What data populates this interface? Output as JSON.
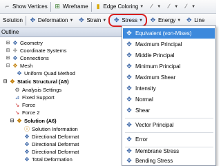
{
  "toolbar1": {
    "show_vertices": "Show Vertices",
    "wireframe": "Wireframe",
    "edge_coloring": "Edge Coloring"
  },
  "toolbar2": {
    "solution": "Solution",
    "deformation": "Deformation",
    "strain": "Strain",
    "stress": "Stress",
    "energy": "Energy",
    "linearized": "Line"
  },
  "outline": {
    "header": "Outline",
    "nodes": [
      {
        "label": "Geometry"
      },
      {
        "label": "Coordinate Systems"
      },
      {
        "label": "Connections"
      },
      {
        "label": "Mesh"
      },
      {
        "label": "Uniform Quad Method"
      },
      {
        "label": "Static Structural (A5)"
      },
      {
        "label": "Analysis Settings"
      },
      {
        "label": "Fixed Support"
      },
      {
        "label": "Force"
      },
      {
        "label": "Force 2"
      },
      {
        "label": "Solution (A6)"
      },
      {
        "label": "Solution Information"
      },
      {
        "label": "Directional Deformat"
      },
      {
        "label": "Directional Deformat"
      },
      {
        "label": "Directional Deformat"
      },
      {
        "label": "Total Deformation"
      }
    ]
  },
  "stress_menu": {
    "items": [
      {
        "label": "Equivalent (von-Mises)",
        "selected": true
      },
      {
        "label": "Maximum Principal"
      },
      {
        "label": "Middle Principal"
      },
      {
        "label": "Minimum Principal"
      },
      {
        "label": "Maximum Shear"
      },
      {
        "label": "Intensity"
      },
      {
        "label": "Normal"
      },
      {
        "label": "Shear"
      },
      {
        "label": "Vector Principal"
      },
      {
        "label": "Error"
      },
      {
        "label": "Membrane Stress"
      },
      {
        "label": "Bending Stress"
      }
    ]
  },
  "colors": {
    "selection": "#3d89dc",
    "highlight_ring": "#d81e1e",
    "toolbar_bg": "#e9ecf1"
  }
}
